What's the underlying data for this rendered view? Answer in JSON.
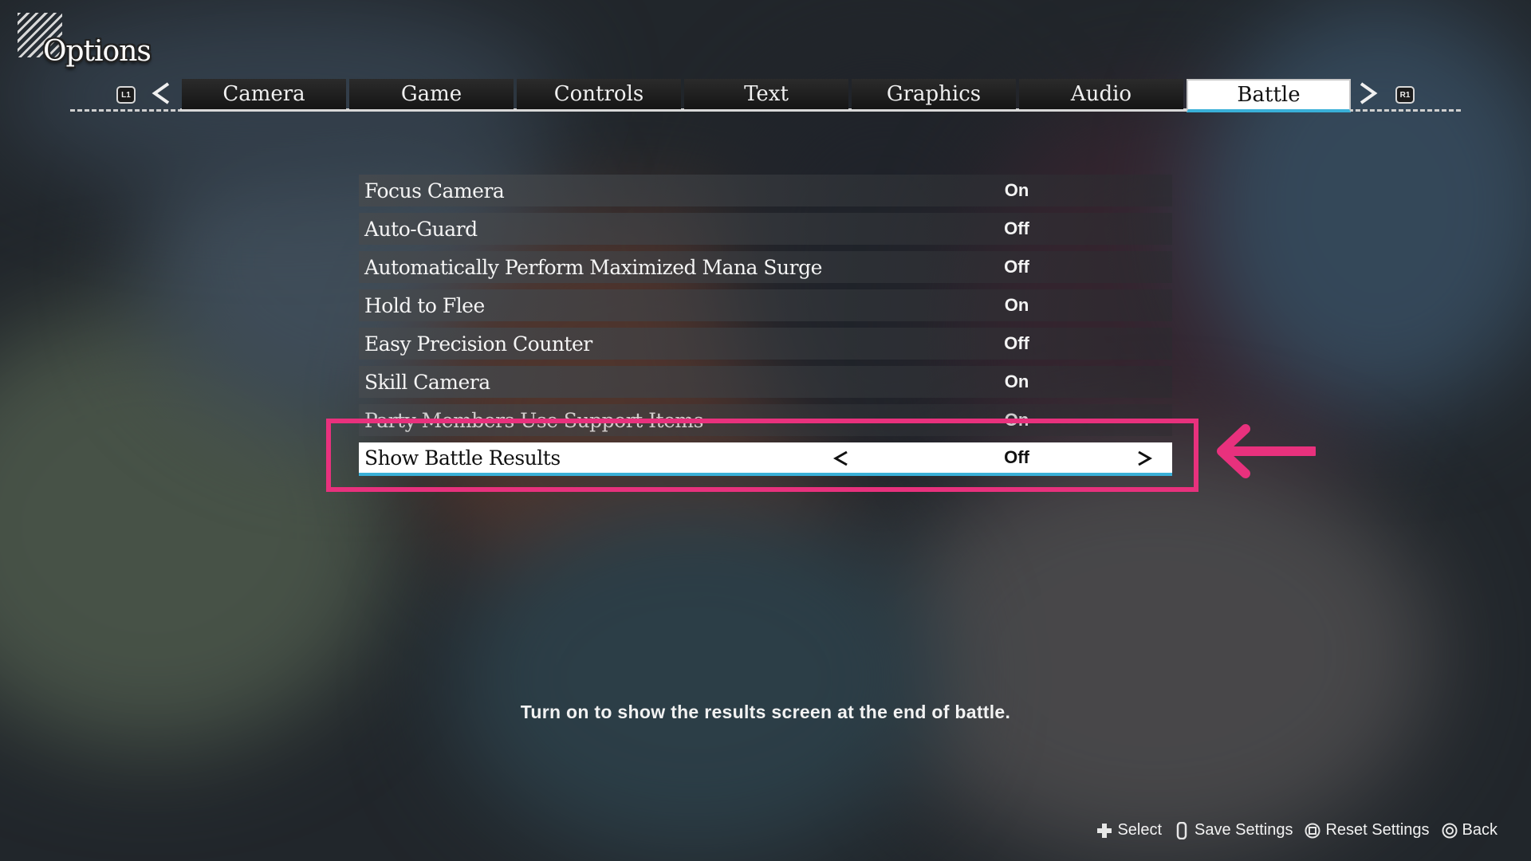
{
  "colors": {
    "accent": "#3ab0d8",
    "highlight": "#e8317d",
    "active_bg": "#ffffff"
  },
  "header": {
    "title": "Options"
  },
  "tabbar": {
    "left_button": "L1",
    "right_button": "R1",
    "left_arrow_icon": "chevron-left-icon",
    "right_arrow_icon": "chevron-right-icon",
    "tabs": [
      {
        "label": "Camera",
        "active": false
      },
      {
        "label": "Game",
        "active": false
      },
      {
        "label": "Controls",
        "active": false
      },
      {
        "label": "Text",
        "active": false
      },
      {
        "label": "Graphics",
        "active": false
      },
      {
        "label": "Audio",
        "active": false
      },
      {
        "label": "Battle",
        "active": true
      }
    ]
  },
  "settings": [
    {
      "label": "Focus Camera",
      "value": "On"
    },
    {
      "label": "Auto-Guard",
      "value": "Off"
    },
    {
      "label": "Automatically Perform Maximized Mana Surge",
      "value": "Off"
    },
    {
      "label": "Hold to Flee",
      "value": "On"
    },
    {
      "label": "Easy Precision Counter",
      "value": "Off"
    },
    {
      "label": "Skill Camera",
      "value": "On"
    },
    {
      "label": "Party Members Use Support Items",
      "value": "On"
    },
    {
      "label": "Show Battle Results",
      "value": "Off",
      "selected": true
    }
  ],
  "description": "Turn on to show the results screen at the end of battle.",
  "footer": {
    "hints": [
      {
        "icon": "dpad-icon",
        "label": "Select"
      },
      {
        "icon": "touchpad-icon",
        "label": "Save Settings"
      },
      {
        "icon": "square-button-icon",
        "label": "Reset Settings"
      },
      {
        "icon": "circle-button-icon",
        "label": "Back"
      }
    ]
  }
}
